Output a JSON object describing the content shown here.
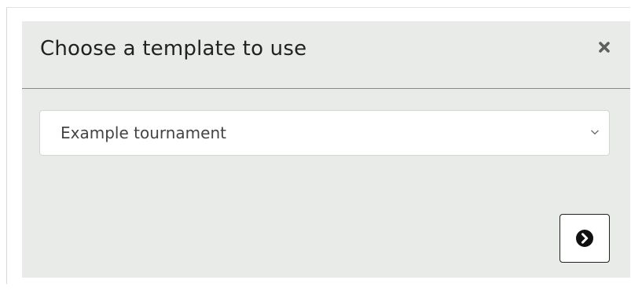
{
  "dialog": {
    "title": "Choose a template to use",
    "close_icon": "close-icon",
    "template_select": {
      "selected_value": "Example tournament",
      "chevron_icon": "chevron-down-icon"
    },
    "next_button": {
      "icon": "chevron-circle-right-icon"
    }
  },
  "colors": {
    "modal_background": "#e9ebe8",
    "header_divider": "#8a8a8a",
    "title_text": "#222222",
    "select_background": "#ffffff",
    "next_icon": "#111111"
  }
}
